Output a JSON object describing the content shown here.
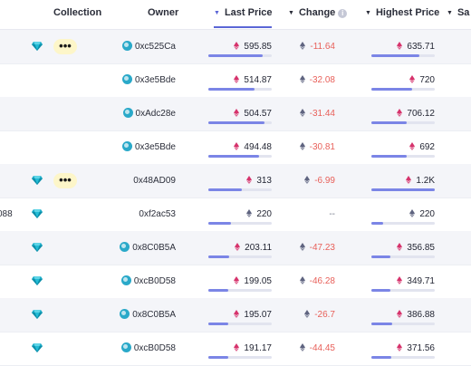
{
  "headers": {
    "collection": "Collection",
    "owner": "Owner",
    "last_price": "Last Price",
    "change": "Change",
    "highest_price": "Highest Price",
    "sales": "Sa"
  },
  "colors": {
    "accent": "#5b66d6",
    "negative": "#e8605a",
    "eth_red": "#d6336c",
    "eth_gray": "#5f6480"
  },
  "rows": [
    {
      "truncated": "",
      "diamond": true,
      "badge": "•••",
      "owner": "0xc525Ca",
      "owner_avatar": true,
      "last_price": "595.85",
      "price_eth": "red",
      "price_fill": 0.85,
      "change": "-11.64",
      "change_eth": "gray",
      "high": "635.71",
      "high_eth": "red",
      "high_fill": 0.75,
      "shade": true
    },
    {
      "truncated": "",
      "diamond": false,
      "badge": "",
      "owner": "0x3e5Bde",
      "owner_avatar": true,
      "last_price": "514.87",
      "price_eth": "red",
      "price_fill": 0.73,
      "change": "-32.08",
      "change_eth": "gray",
      "high": "720",
      "high_eth": "red",
      "high_fill": 0.64,
      "shade": false
    },
    {
      "truncated": "",
      "diamond": false,
      "badge": "",
      "owner": "0xAdc28e",
      "owner_avatar": true,
      "last_price": "504.57",
      "price_eth": "red",
      "price_fill": 0.88,
      "change": "-31.44",
      "change_eth": "gray",
      "high": "706.12",
      "high_eth": "red",
      "high_fill": 0.56,
      "shade": true
    },
    {
      "truncated": "",
      "diamond": false,
      "badge": "",
      "owner": "0x3e5Bde",
      "owner_avatar": true,
      "last_price": "494.48",
      "price_eth": "red",
      "price_fill": 0.8,
      "change": "-30.81",
      "change_eth": "gray",
      "high": "692",
      "high_eth": "red",
      "high_fill": 0.55,
      "shade": false
    },
    {
      "truncated": "",
      "diamond": true,
      "badge": "•••",
      "owner": "0x48AD09",
      "owner_avatar": false,
      "last_price": "313",
      "price_eth": "red",
      "price_fill": 0.53,
      "change": "-6.99",
      "change_eth": "gray",
      "high": "1.2K",
      "high_eth": "red",
      "high_fill": 1.0,
      "shade": true
    },
    {
      "truncated": "088",
      "diamond": true,
      "badge": "",
      "owner": "0xf2ac53",
      "owner_avatar": false,
      "last_price": "220",
      "price_eth": "gray",
      "price_fill": 0.36,
      "change": "--",
      "change_eth": "none",
      "high": "220",
      "high_eth": "gray",
      "high_fill": 0.18,
      "shade": false
    },
    {
      "truncated": "",
      "diamond": true,
      "badge": "",
      "owner": "0x8C0B5A",
      "owner_avatar": true,
      "last_price": "203.11",
      "price_eth": "red",
      "price_fill": 0.33,
      "change": "-47.23",
      "change_eth": "gray",
      "high": "356.85",
      "high_eth": "red",
      "high_fill": 0.3,
      "shade": true
    },
    {
      "truncated": "",
      "diamond": true,
      "badge": "",
      "owner": "0xcB0D58",
      "owner_avatar": true,
      "last_price": "199.05",
      "price_eth": "red",
      "price_fill": 0.32,
      "change": "-46.28",
      "change_eth": "gray",
      "high": "349.71",
      "high_eth": "red",
      "high_fill": 0.3,
      "shade": false
    },
    {
      "truncated": "",
      "diamond": true,
      "badge": "",
      "owner": "0x8C0B5A",
      "owner_avatar": true,
      "last_price": "195.07",
      "price_eth": "red",
      "price_fill": 0.31,
      "change": "-26.7",
      "change_eth": "gray",
      "high": "386.88",
      "high_eth": "red",
      "high_fill": 0.33,
      "shade": true
    },
    {
      "truncated": "",
      "diamond": true,
      "badge": "",
      "owner": "0xcB0D58",
      "owner_avatar": true,
      "last_price": "191.17",
      "price_eth": "red",
      "price_fill": 0.32,
      "change": "-44.45",
      "change_eth": "gray",
      "high": "371.56",
      "high_eth": "red",
      "high_fill": 0.31,
      "shade": false
    }
  ]
}
